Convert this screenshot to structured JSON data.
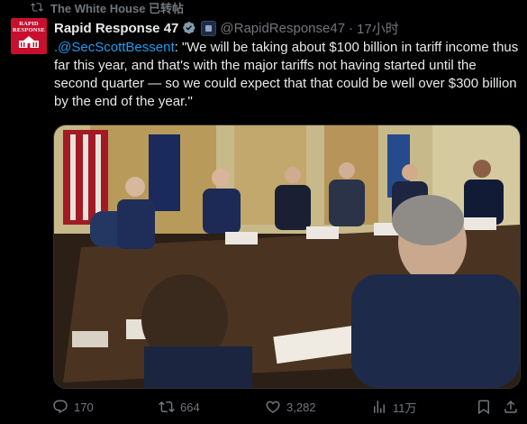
{
  "repost": {
    "text": "The White House 已转帖",
    "icon": "repost-icon"
  },
  "author": {
    "avatar_text_line1": "RAPID",
    "avatar_text_line2": "RESPONSE",
    "name": "Rapid Response 47",
    "handle": "@RapidResponse47",
    "separator": "·",
    "time": "17小时",
    "verified_color": "#1d9bf0"
  },
  "tweet": {
    "mention": ".@SecScottBessent",
    "body": ": \"We will be taking about $100 billion in tariff income thus far this year, and that's with the major tariffs not having started until the second quarter — so we could expect that that could be well over $300 billion by the end of the year.\""
  },
  "media": {
    "description_icon": "cabinet-meeting-video"
  },
  "actions": {
    "replies": "170",
    "reposts": "664",
    "likes": "3,282",
    "views": "11万"
  },
  "colors": {
    "background": "#000000",
    "text": "#e7e9ea",
    "muted": "#71767b",
    "link": "#1d9bf0"
  }
}
